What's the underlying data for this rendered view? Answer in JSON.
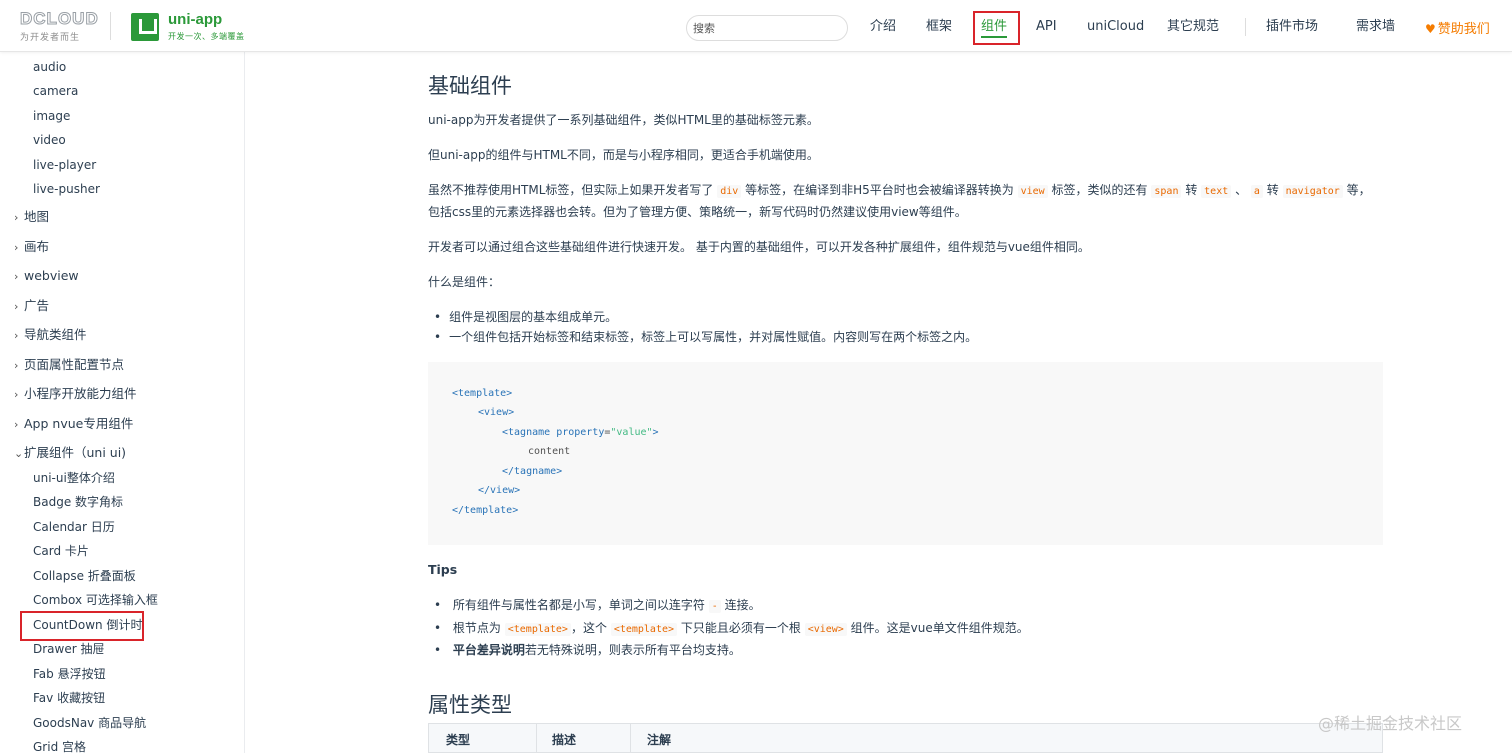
{
  "header": {
    "brand_mark": "DCLOUD",
    "brand_slogan": "为开发者而生",
    "product_name": "uni-app",
    "product_tagline": "开发一次、多端覆盖",
    "search_placeholder": "搜索",
    "nav": [
      "介绍",
      "框架",
      "组件",
      "API",
      "uniCloud",
      "其它规范",
      "插件市场",
      "需求墙"
    ],
    "active_nav": "组件",
    "sponsor_label": "赞助我们",
    "accent_color": "#2b9939",
    "highlight_color": "#d9242a"
  },
  "sidebar": {
    "top_items": [
      "audio",
      "camera",
      "image",
      "video",
      "live-player",
      "live-pusher"
    ],
    "groups": [
      "地图",
      "画布",
      "webview",
      "广告",
      "导航类组件",
      "页面属性配置节点",
      "小程序开放能力组件",
      "App nvue专用组件",
      "扩展组件（uni ui)"
    ],
    "sub_items": [
      "uni-ui整体介绍",
      "Badge 数字角标",
      "Calendar 日历",
      "Card 卡片",
      "Collapse 折叠面板",
      "Combox 可选择输入框",
      "CountDown 倒计时",
      "Drawer 抽屉",
      "Fab 悬浮按钮",
      "Fav 收藏按钮",
      "GoodsNav 商品导航",
      "Grid 宫格"
    ],
    "highlighted_item": "CountDown 倒计时"
  },
  "content": {
    "title": "基础组件",
    "p1": "uni-app为开发者提供了一系列基础组件，类似HTML里的基础标签元素。",
    "p2": "但uni-app的组件与HTML不同，而是与小程序相同，更适合手机端使用。",
    "p3_a": "虽然不推荐使用HTML标签，但实际上如果开发者写了",
    "p3_code1": "div",
    "p3_b": "等标签，在编译到非H5平台时也会被编译器转换为",
    "p3_code2": "view",
    "p3_c": "标签，类似的还有",
    "p3_code3": "span",
    "p3_d": "转",
    "p3_code4": "text",
    "p3_e": "、",
    "p3_code5": "a",
    "p3_f": "转",
    "p3_code6": "navigator",
    "p3_g": "等，",
    "p3_line2": "包括css里的元素选择器也会转。但为了管理方便、策略统一，新写代码时仍然建议使用view等组件。",
    "p4": "开发者可以通过组合这些基础组件进行快速开发。 基于内置的基础组件，可以开发各种扩展组件，组件规范与vue组件相同。",
    "p5": "什么是组件：",
    "bullets1": [
      "组件是视图层的基本组成单元。",
      "一个组件包括开始标签和结束标签，标签上可以写属性，并对属性赋值。内容则写在两个标签之内。"
    ],
    "code": {
      "l1": "<template>",
      "l2": "<view>",
      "l3_tag": "<tagname ",
      "l3_attr": "property",
      "l3_eq": "=",
      "l3_str": "\"value\"",
      "l3_end": ">",
      "l4": "content",
      "l5": "</tagname>",
      "l6": "</view>",
      "l7": "</template>"
    },
    "tips_title": "Tips",
    "tip1_a": "所有组件与属性名都是小写，单词之间以连字符",
    "tip1_code": "-",
    "tip1_b": "连接。",
    "tip2_a": "根节点为",
    "tip2_code1": "<template>",
    "tip2_b": "，这个",
    "tip2_code2": "<template>",
    "tip2_c": "下只能且必须有一个根",
    "tip2_code3": "<view>",
    "tip2_d": "组件。这是vue单文件组件规范。",
    "tip3_bold": "平台差异说明",
    "tip3_rest": "若无特殊说明，则表示所有平台均支持。",
    "section2_title": "属性类型",
    "table_headers": [
      "类型",
      "描述",
      "注解"
    ]
  },
  "watermark": "@稀土掘金技术社区"
}
